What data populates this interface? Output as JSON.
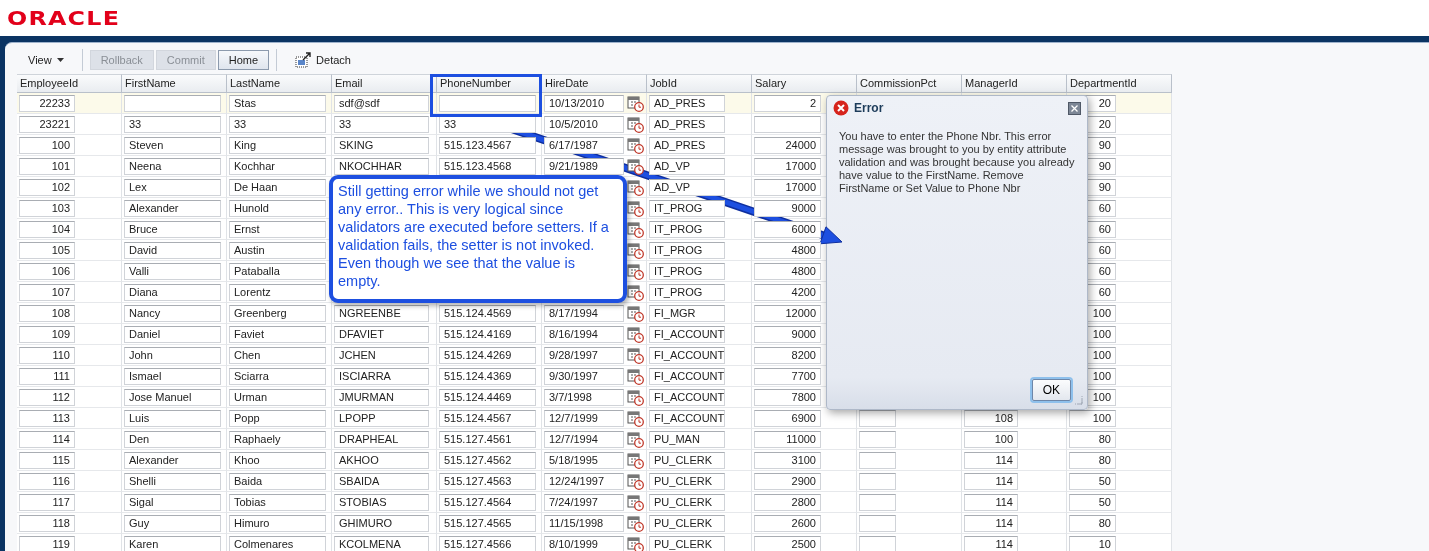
{
  "logo": {
    "text": "ORACLE"
  },
  "toolbar": {
    "menu": {
      "label": "View"
    },
    "buttons": [
      {
        "label": "Rollback",
        "disabled": true
      },
      {
        "label": "Commit",
        "disabled": true
      },
      {
        "label": "Home",
        "disabled": false
      }
    ],
    "detach": {
      "label": "Detach"
    }
  },
  "table": {
    "columns": [
      {
        "label": "EmployeeId",
        "kind": "number"
      },
      {
        "label": "FirstName",
        "kind": "text"
      },
      {
        "label": "LastName",
        "kind": "text"
      },
      {
        "label": "Email",
        "kind": "text"
      },
      {
        "label": "PhoneNumber",
        "kind": "text"
      },
      {
        "label": "HireDate",
        "kind": "date"
      },
      {
        "label": "JobId",
        "kind": "text"
      },
      {
        "label": "Salary",
        "kind": "number"
      },
      {
        "label": "CommissionPct",
        "kind": "number"
      },
      {
        "label": "ManagerId",
        "kind": "number"
      },
      {
        "label": "DepartmentId",
        "kind": "number"
      }
    ],
    "rows": [
      {
        "selected": true,
        "cells": [
          "22233",
          null,
          "Stas",
          "sdf@sdf",
          null,
          "10/13/2010",
          "AD_PRES",
          "2",
          null,
          null,
          "20"
        ]
      },
      {
        "selected": false,
        "cells": [
          "23221",
          "33",
          "33",
          "33",
          "33",
          "10/5/2010",
          "AD_PRES",
          null,
          null,
          null,
          "20"
        ]
      },
      {
        "selected": false,
        "cells": [
          "100",
          "Steven",
          "King",
          "SKING",
          "515.123.4567",
          "6/17/1987",
          "AD_PRES",
          "24000",
          null,
          null,
          "90"
        ]
      },
      {
        "selected": false,
        "cells": [
          "101",
          "Neena",
          "Kochhar",
          "NKOCHHAR",
          "515.123.4568",
          "9/21/1989",
          "AD_VP",
          "17000",
          null,
          null,
          "90"
        ]
      },
      {
        "selected": false,
        "cells": [
          "102",
          "Lex",
          "De Haan",
          null,
          null,
          null,
          "AD_VP",
          "17000",
          null,
          null,
          "90"
        ]
      },
      {
        "selected": false,
        "cells": [
          "103",
          "Alexander",
          "Hunold",
          null,
          null,
          null,
          "IT_PROG",
          "9000",
          null,
          null,
          "60"
        ]
      },
      {
        "selected": false,
        "cells": [
          "104",
          "Bruce",
          "Ernst",
          null,
          null,
          null,
          "IT_PROG",
          "6000",
          null,
          null,
          "60"
        ]
      },
      {
        "selected": false,
        "cells": [
          "105",
          "David",
          "Austin",
          null,
          null,
          null,
          "IT_PROG",
          "4800",
          null,
          null,
          "60"
        ]
      },
      {
        "selected": false,
        "cells": [
          "106",
          "Valli",
          "Pataballa",
          null,
          null,
          null,
          "IT_PROG",
          "4800",
          null,
          null,
          "60"
        ]
      },
      {
        "selected": false,
        "cells": [
          "107",
          "Diana",
          "Lorentz",
          null,
          null,
          null,
          "IT_PROG",
          "4200",
          null,
          null,
          "60"
        ]
      },
      {
        "selected": false,
        "cells": [
          "108",
          "Nancy",
          "Greenberg",
          "NGREENBE",
          "515.124.4569",
          "8/17/1994",
          "FI_MGR",
          "12000",
          null,
          null,
          "100"
        ]
      },
      {
        "selected": false,
        "cells": [
          "109",
          "Daniel",
          "Faviet",
          "DFAVIET",
          "515.124.4169",
          "8/16/1994",
          "FI_ACCOUNT",
          "9000",
          null,
          null,
          "100"
        ]
      },
      {
        "selected": false,
        "cells": [
          "110",
          "John",
          "Chen",
          "JCHEN",
          "515.124.4269",
          "9/28/1997",
          "FI_ACCOUNT",
          "8200",
          null,
          null,
          "100"
        ]
      },
      {
        "selected": false,
        "cells": [
          "111",
          "Ismael",
          "Sciarra",
          "ISCIARRA",
          "515.124.4369",
          "9/30/1997",
          "FI_ACCOUNT",
          "7700",
          null,
          null,
          "100"
        ]
      },
      {
        "selected": false,
        "cells": [
          "112",
          "Jose Manuel",
          "Urman",
          "JMURMAN",
          "515.124.4469",
          "3/7/1998",
          "FI_ACCOUNT",
          "7800",
          null,
          null,
          "100"
        ]
      },
      {
        "selected": false,
        "cells": [
          "113",
          "Luis",
          "Popp",
          "LPOPP",
          "515.124.4567",
          "12/7/1999",
          "FI_ACCOUNT",
          "6900",
          null,
          "108",
          "100"
        ]
      },
      {
        "selected": false,
        "cells": [
          "114",
          "Den",
          "Raphaely",
          "DRAPHEAL",
          "515.127.4561",
          "12/7/1994",
          "PU_MAN",
          "11000",
          null,
          "100",
          "80"
        ]
      },
      {
        "selected": false,
        "cells": [
          "115",
          "Alexander",
          "Khoo",
          "AKHOO",
          "515.127.4562",
          "5/18/1995",
          "PU_CLERK",
          "3100",
          null,
          "114",
          "80"
        ]
      },
      {
        "selected": false,
        "cells": [
          "116",
          "Shelli",
          "Baida",
          "SBAIDA",
          "515.127.4563",
          "12/24/1997",
          "PU_CLERK",
          "2900",
          null,
          "114",
          "50"
        ]
      },
      {
        "selected": false,
        "cells": [
          "117",
          "Sigal",
          "Tobias",
          "STOBIAS",
          "515.127.4564",
          "7/24/1997",
          "PU_CLERK",
          "2800",
          null,
          "114",
          "50"
        ]
      },
      {
        "selected": false,
        "cells": [
          "118",
          "Guy",
          "Himuro",
          "GHIMURO",
          "515.127.4565",
          "11/15/1998",
          "PU_CLERK",
          "2600",
          null,
          "114",
          "80"
        ]
      },
      {
        "selected": false,
        "cells": [
          "119",
          "Karen",
          "Colmenares",
          "KCOLMENA",
          "515.127.4566",
          "8/10/1999",
          "PU_CLERK",
          "2500",
          null,
          "114",
          "10"
        ]
      }
    ]
  },
  "callout": {
    "text": "Still getting error while we should not get any error.. This is very logical since validators are executed before setters. If a validation fails, the setter is not invoked. Even though we see that the value is empty."
  },
  "error_dialog": {
    "title": "Error",
    "message": "You have to enter the Phone Nbr. This error message was brought to you by entity attribute validation and was brought because you already have value to the FirstName. Remove FirstName or Set Value to Phone Nbr",
    "button": "OK"
  }
}
